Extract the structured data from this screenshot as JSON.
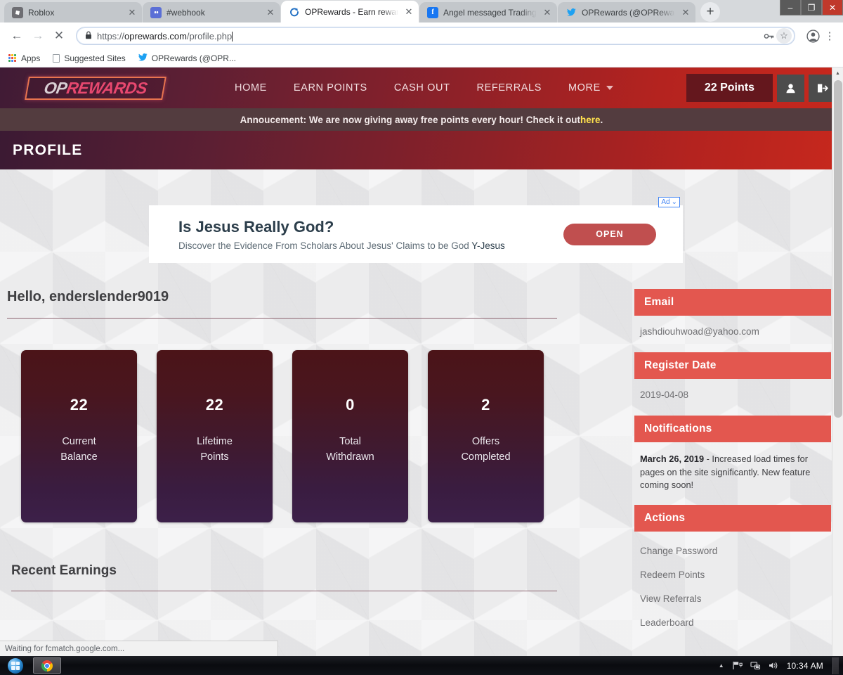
{
  "browser": {
    "tabs": [
      {
        "title": "Roblox",
        "favicon": "roblox-icon",
        "active": false,
        "close_label": "✕"
      },
      {
        "title": "#webhook",
        "favicon": "discord-icon",
        "active": false,
        "close_label": "✕"
      },
      {
        "title": "OPRewards - Earn rewards fo",
        "favicon": "oprewards-icon",
        "active": true,
        "close_label": "✕"
      },
      {
        "title": "Angel messaged Trading Ro",
        "favicon": "facebook-icon",
        "active": false,
        "close_label": "✕"
      },
      {
        "title": "OPRewards (@OPReward) | T",
        "favicon": "twitter-icon",
        "active": false,
        "close_label": "✕"
      }
    ],
    "new_tab_label": "+",
    "window_controls": {
      "minimize": "–",
      "maximize": "❐",
      "close": "✕"
    },
    "nav": {
      "back": "←",
      "forward": "→",
      "stop": "✕",
      "lock_icon": "lock-icon",
      "url_scheme": "https://",
      "url_host": "oprewards.com",
      "url_path": "/profile.php",
      "manage_passwords": "⚷",
      "bookmark_star": "☆",
      "profile_avatar": "●",
      "menu": "⋮"
    },
    "bookmarks": [
      {
        "label": "Apps",
        "icon": "apps-grid-icon"
      },
      {
        "label": "Suggested Sites",
        "icon": "document-icon"
      },
      {
        "label": "OPRewards (@OPR...",
        "icon": "twitter-icon"
      }
    ],
    "status_text": "Waiting for fcmatch.google.com..."
  },
  "site": {
    "logo": {
      "part1": "OP",
      "part2": "REWARDS"
    },
    "nav_links": [
      "HOME",
      "EARN POINTS",
      "CASH OUT",
      "REFERRALS"
    ],
    "more_label": "MORE",
    "points_label": "22 Points",
    "profile_icon": "user-icon",
    "logout_icon": "logout-icon",
    "announcement": {
      "text": "Annoucement: We are now giving away free points every hour! Check it out ",
      "link": "here",
      "suffix": "."
    },
    "banner_title": "PROFILE"
  },
  "ad": {
    "badge": "Ad",
    "badge_caret": "⌄",
    "title": "Is Jesus Really God?",
    "subtitle": "Discover the Evidence From Scholars About Jesus' Claims to be God ",
    "brand": "Y-Jesus",
    "button": "OPEN"
  },
  "profile": {
    "greeting": "Hello, enderslender9019",
    "stats": [
      {
        "value": "22",
        "label_line1": "Current",
        "label_line2": "Balance"
      },
      {
        "value": "22",
        "label_line1": "Lifetime",
        "label_line2": "Points"
      },
      {
        "value": "0",
        "label_line1": "Total",
        "label_line2": "Withdrawn"
      },
      {
        "value": "2",
        "label_line1": "Offers",
        "label_line2": "Completed"
      }
    ],
    "recent_earnings_title": "Recent Earnings"
  },
  "sidebar": {
    "email_heading": "Email",
    "email_value": "jashdiouhwoad@yahoo.com",
    "register_heading": "Register Date",
    "register_value": "2019-04-08",
    "notifications_heading": "Notifications",
    "notification_date": "March 26, 2019",
    "notification_text": " - Increased load times for pages on the site significantly. New feature coming soon!",
    "actions_heading": "Actions",
    "actions": [
      "Change Password",
      "Redeem Points",
      "View Referrals",
      "Leaderboard"
    ]
  },
  "taskbar": {
    "start_label": "start-orb",
    "items": [
      {
        "icon": "chrome-icon"
      }
    ],
    "tray": {
      "show_hidden": "▲",
      "flag_icon": "action-center-icon",
      "network_icon": "network-icon",
      "volume_icon": "volume-icon",
      "time": "10:34 AM"
    }
  },
  "colors": {
    "accent_red": "#e3574f",
    "nav_gradient_start": "#401b35",
    "nav_gradient_end": "#c7281d",
    "points_pill": "#64171d",
    "card_top": "#4b1418",
    "card_bottom": "#3c2049",
    "link_yellow": "#ffe14d"
  }
}
